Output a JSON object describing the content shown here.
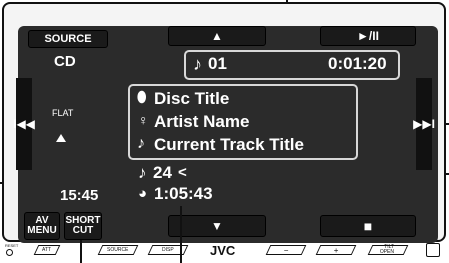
{
  "header": {
    "source_label": "SOURCE",
    "up_label": "▲",
    "play_pause_label": "►/II"
  },
  "source_name": "CD",
  "track": {
    "number": "01",
    "elapsed": "0:01:20",
    "disc_title": "Disc Title",
    "artist_name": "Artist Name",
    "track_title": "Current Track Title",
    "total_tracks": "24",
    "total_time": "1:05:43"
  },
  "eq_label": "FLAT",
  "clock": "15:45",
  "nav": {
    "prev_label": "I◀◀",
    "next_label": "▶▶I"
  },
  "footer_buttons": {
    "av_menu_label_1": "AV",
    "av_menu_label_2": "MENU",
    "short_cut_label_1": "SHORT",
    "short_cut_label_2": "CUT",
    "down_label": "▼",
    "stop_label": "■"
  },
  "panel_keys": {
    "reset": "RESET",
    "att": "ATT",
    "source": "SOURCE",
    "disp": "DISP",
    "brand": "JVC",
    "minus": "−",
    "plus": "+",
    "tilt_open_1": "TILT",
    "tilt_open_2": "OPEN"
  },
  "icons": {
    "note": "music-note-icon",
    "disc": "disc-icon",
    "person": "artist-icon",
    "clock": "clock-icon"
  }
}
